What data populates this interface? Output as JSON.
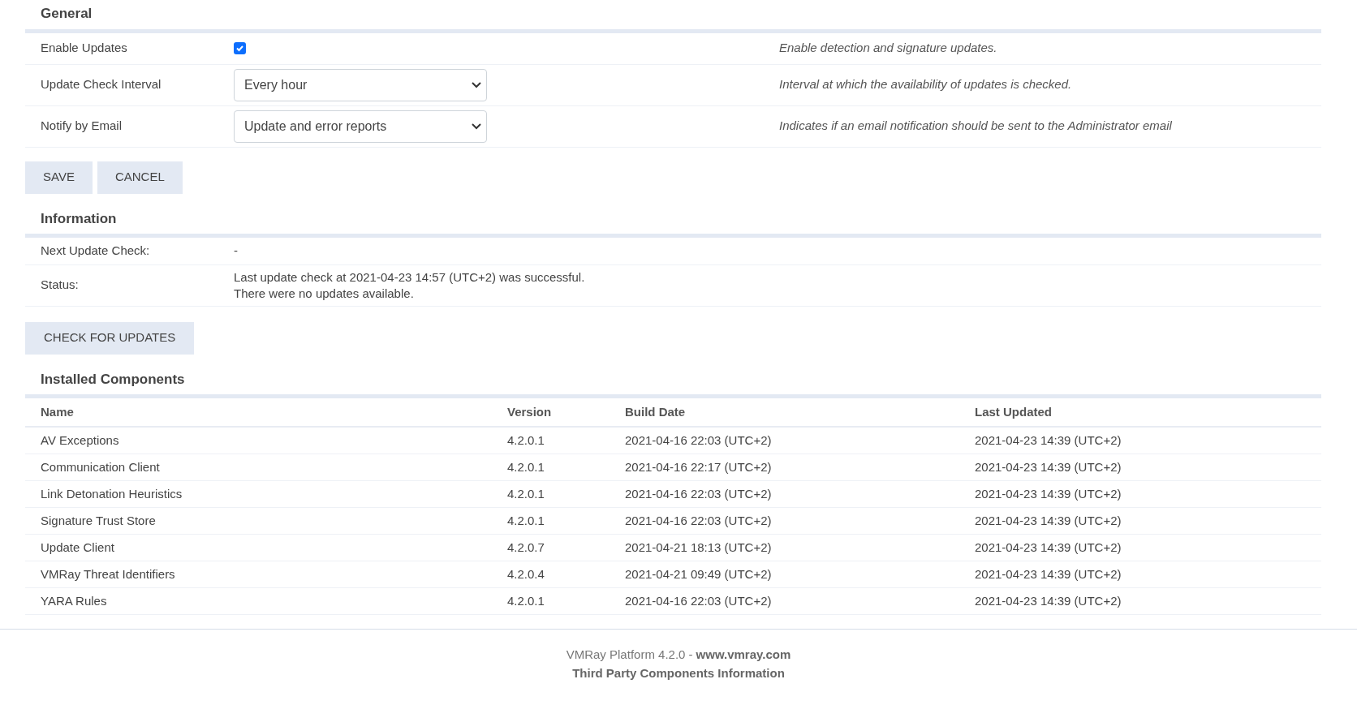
{
  "general": {
    "title": "General",
    "settings": [
      {
        "kind": "checkbox",
        "label": "Enable Updates",
        "checked": true,
        "description": "Enable detection and signature updates."
      },
      {
        "kind": "select",
        "label": "Update Check Interval",
        "value": "Every hour",
        "description": "Interval at which the availability of updates is checked."
      },
      {
        "kind": "select",
        "label": "Notify by Email",
        "value": "Update and error reports",
        "description": "Indicates if an email notification should be sent to the Administrator email"
      }
    ],
    "buttons": [
      "SAVE",
      "CANCEL"
    ]
  },
  "information": {
    "title": "Information",
    "rows": [
      {
        "label": "Next Update Check:",
        "lines": [
          "-"
        ]
      },
      {
        "label": "Status:",
        "lines": [
          "Last update check at 2021-04-23 14:57 (UTC+2) was successful.",
          "There were no updates available."
        ]
      }
    ],
    "button": "CHECK FOR UPDATES"
  },
  "installed_components": {
    "title": "Installed Components",
    "columns": [
      "Name",
      "Version",
      "Build Date",
      "Last Updated"
    ],
    "rows": [
      [
        "AV Exceptions",
        "4.2.0.1",
        "2021-04-16 22:03 (UTC+2)",
        "2021-04-23 14:39 (UTC+2)"
      ],
      [
        "Communication Client",
        "4.2.0.1",
        "2021-04-16 22:17 (UTC+2)",
        "2021-04-23 14:39 (UTC+2)"
      ],
      [
        "Link Detonation Heuristics",
        "4.2.0.1",
        "2021-04-16 22:03 (UTC+2)",
        "2021-04-23 14:39 (UTC+2)"
      ],
      [
        "Signature Trust Store",
        "4.2.0.1",
        "2021-04-16 22:03 (UTC+2)",
        "2021-04-23 14:39 (UTC+2)"
      ],
      [
        "Update Client",
        "4.2.0.7",
        "2021-04-21 18:13 (UTC+2)",
        "2021-04-23 14:39 (UTC+2)"
      ],
      [
        "VMRay Threat Identifiers",
        "4.2.0.4",
        "2021-04-21 09:49 (UTC+2)",
        "2021-04-23 14:39 (UTC+2)"
      ],
      [
        "YARA Rules",
        "4.2.0.1",
        "2021-04-16 22:03 (UTC+2)",
        "2021-04-23 14:39 (UTC+2)"
      ]
    ]
  },
  "footer": {
    "product": "VMRay Platform 4.2.0 -",
    "website": "www.vmray.com",
    "third_party_link": "Third Party Components Information"
  }
}
